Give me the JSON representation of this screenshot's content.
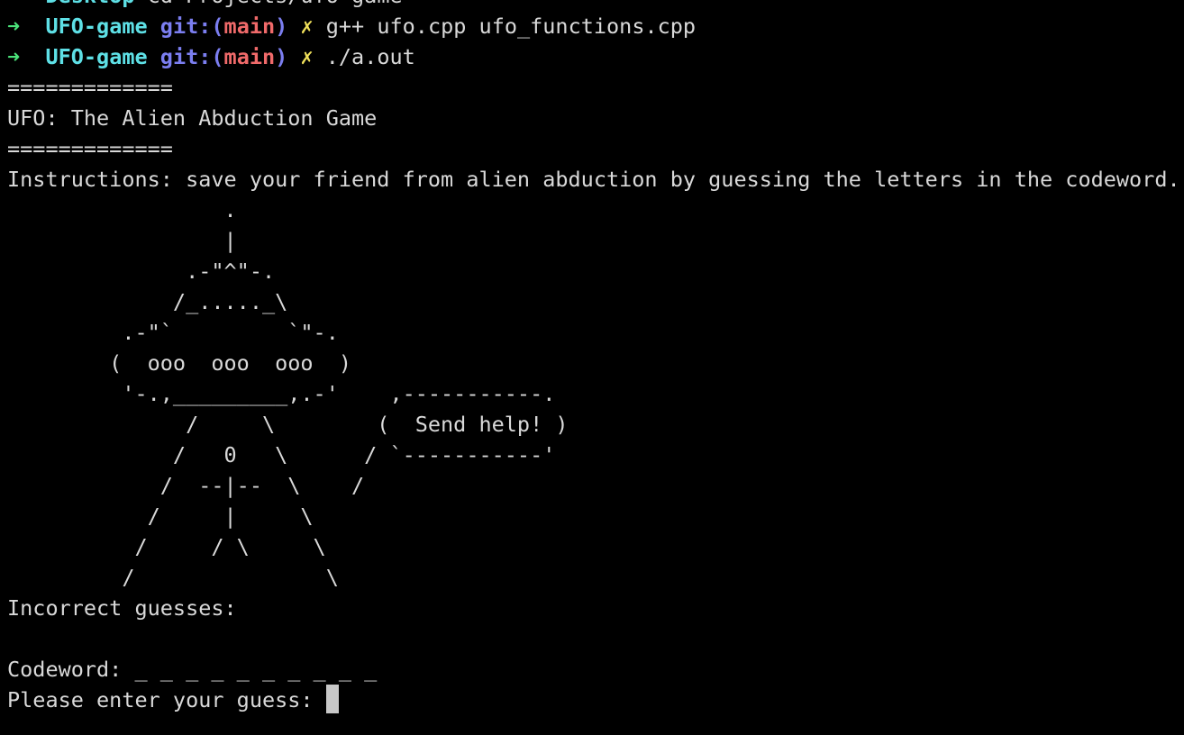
{
  "colors": {
    "background": "#000000",
    "text": "#d9d9d9",
    "prompt_arrow": "#4be37a",
    "directory": "#5ee0e6",
    "git_label": "#7b7ef0",
    "branch": "#f06a6a",
    "dirty_marker": "#f0e05a",
    "cursor": "#c8c8c8"
  },
  "partial_line": {
    "dir": "Desktop",
    "cmd": "cd Projects/ufo-game"
  },
  "prompts": [
    {
      "arrow": "➜",
      "dir": "UFO-game",
      "git_open": "git:(",
      "branch": "main",
      "git_close": ")",
      "dirty": "✗",
      "command": "g++ ufo.cpp ufo_functions.cpp"
    },
    {
      "arrow": "➜",
      "dir": "UFO-game",
      "git_open": "git:(",
      "branch": "main",
      "git_close": ")",
      "dirty": "✗",
      "command": "./a.out"
    }
  ],
  "output": {
    "divider": "=============",
    "title": "UFO: The Alien Abduction Game",
    "instructions": "Instructions: save your friend from alien abduction by guessing the letters in the codeword.",
    "ascii_art": "                 .\n                 |\n              .-\"^\"-.\n             /_....._\\\n         .-\"`         `\"-.\n        (  ooo  ooo  ooo  )\n         '-.,_________,.-'    ,-----------.\n              /     \\        (  Send help! )\n             /   0   \\      / `-----------'\n            /  --|--  \\    /\n           /     |     \\\n          /     / \\     \\\n         /               \\",
    "incorrect_label": "Incorrect guesses:",
    "codeword_label": "Codeword: _ _ _ _ _ _ _ _ _ _",
    "guess_prompt": "Please enter your guess: "
  }
}
